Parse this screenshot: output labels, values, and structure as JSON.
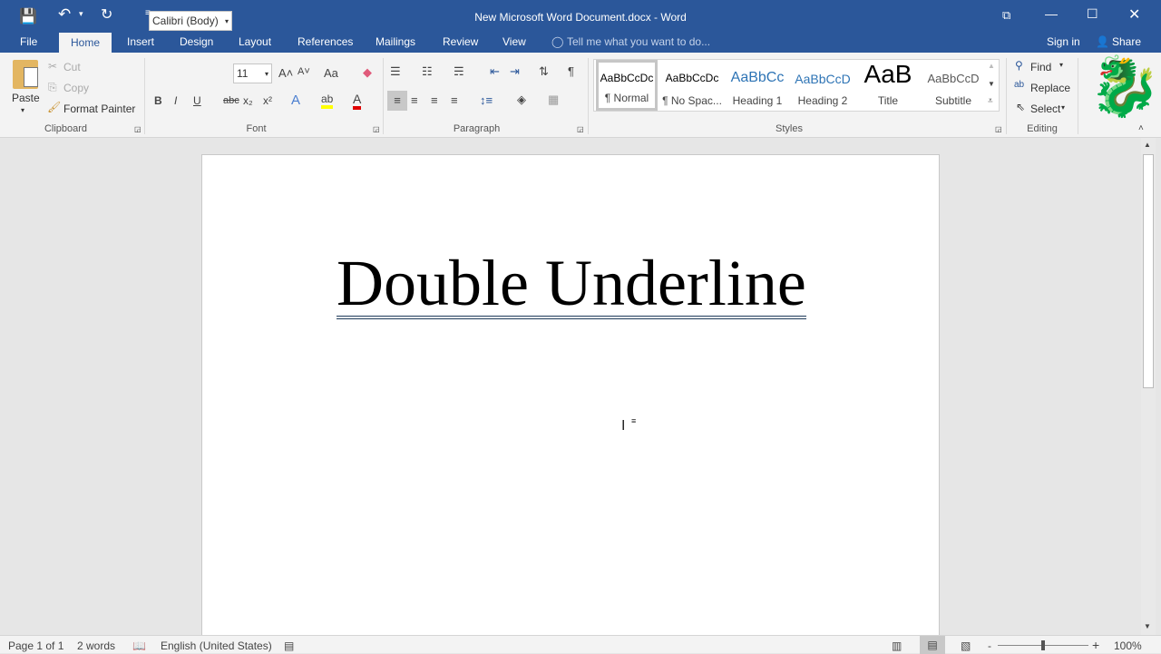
{
  "window": {
    "title": "New Microsoft Word Document.docx - Word",
    "sign_in": "Sign in",
    "share": "Share"
  },
  "qat": {
    "save": "save-icon",
    "undo": "undo-icon",
    "redo": "redo-icon",
    "customize": "customize-icon"
  },
  "tabs": [
    "File",
    "Home",
    "Insert",
    "Design",
    "Layout",
    "References",
    "Mailings",
    "Review",
    "View"
  ],
  "tell_me": "Tell me what you want to do...",
  "clipboard": {
    "paste": "Paste",
    "cut": "Cut",
    "copy": "Copy",
    "format_painter": "Format Painter",
    "label": "Clipboard"
  },
  "font": {
    "name": "Calibri (Body)",
    "size": "11",
    "label": "Font",
    "bold": "B",
    "italic": "I",
    "underline": "U",
    "strike": "abc",
    "sub": "x₂",
    "sup": "x²",
    "grow": "A˄",
    "shrink": "A˅",
    "case": "Aa"
  },
  "paragraph": {
    "label": "Paragraph"
  },
  "styles": {
    "label": "Styles",
    "items": [
      {
        "preview": "AaBbCcDc",
        "name": "¶ Normal"
      },
      {
        "preview": "AaBbCcDc",
        "name": "¶ No Spac..."
      },
      {
        "preview": "AaBbCc",
        "name": "Heading 1"
      },
      {
        "preview": "AaBbCcD",
        "name": "Heading 2"
      },
      {
        "preview": "AaB",
        "name": "Title"
      },
      {
        "preview": "AaBbCcD",
        "name": "Subtitle"
      }
    ]
  },
  "editing": {
    "find": "Find",
    "replace": "Replace",
    "select": "Select",
    "label": "Editing"
  },
  "document": {
    "heading": "Double Underline"
  },
  "status": {
    "page": "Page 1 of 1",
    "words": "2 words",
    "language": "English (United States)",
    "zoom": "100%",
    "zoom_minus": "-",
    "zoom_plus": "+"
  },
  "colors": {
    "brand": "#2b579a",
    "highlight": "#ffff00",
    "font_color": "#e00000"
  }
}
